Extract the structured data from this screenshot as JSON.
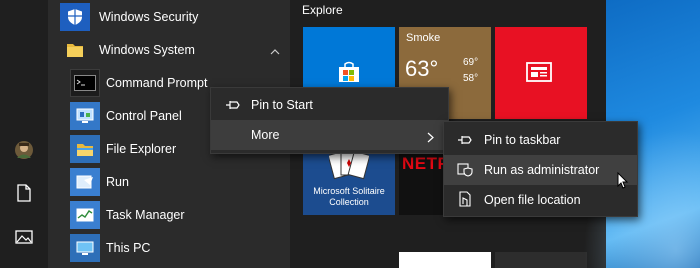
{
  "app_list": {
    "items": [
      {
        "label": "Windows Security"
      },
      {
        "label": "Windows System"
      },
      {
        "label": "Command Prompt"
      },
      {
        "label": "Control Panel"
      },
      {
        "label": "File Explorer"
      },
      {
        "label": "Run"
      },
      {
        "label": "Task Manager"
      },
      {
        "label": "This PC"
      }
    ]
  },
  "tiles": {
    "group_title": "Explore",
    "weather": {
      "city": "Smoke",
      "temp": "63°",
      "high": "69°",
      "low": "58°"
    },
    "solitaire": {
      "caption": "Microsoft Solitaire Collection"
    },
    "netflix": {
      "text": "NETFLIX"
    }
  },
  "context_menu": {
    "pin_to_start": "Pin to Start",
    "more": "More"
  },
  "submenu": {
    "pin_to_taskbar": "Pin to taskbar",
    "run_as_admin": "Run as administrator",
    "open_file_location": "Open file location"
  },
  "colors": {
    "store_blue": "#0078d7",
    "weather_brown": "#8c6a3c",
    "news_red": "#e81123",
    "netflix_red": "#e50914"
  }
}
